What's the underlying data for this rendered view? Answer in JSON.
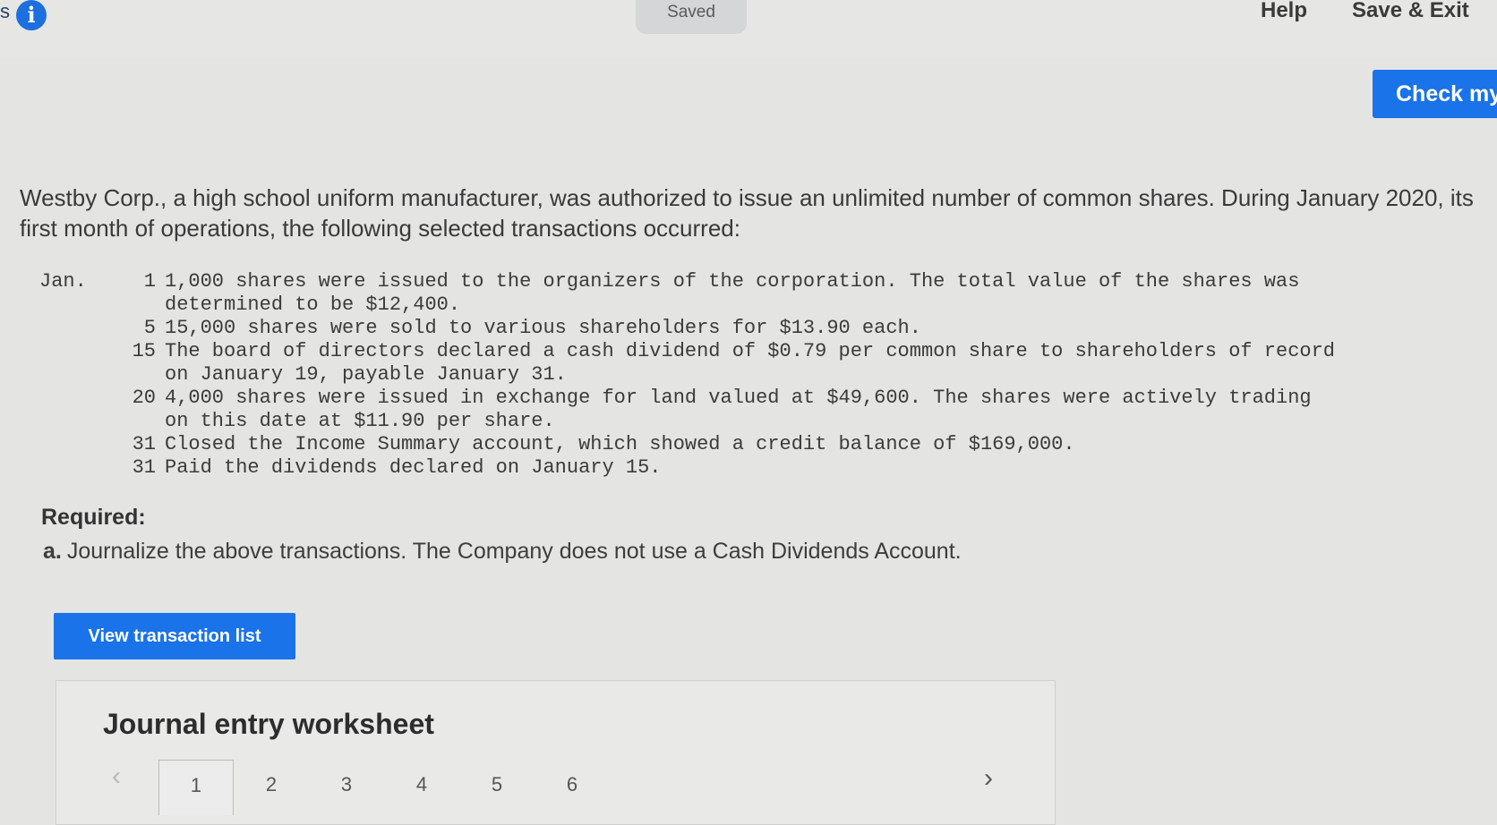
{
  "topbar": {
    "edge_char": "s",
    "info_icon": "info-icon",
    "saved_label": "Saved",
    "help_label": "Help",
    "save_exit_label": "Save & Exit"
  },
  "check_button_label": "Check my",
  "intro_text": "Westby Corp., a high school uniform manufacturer, was authorized to issue an unlimited number of common shares. During January 2020, its first month of operations, the following selected transactions occurred:",
  "transactions": {
    "month": "Jan.",
    "rows": [
      {
        "day": "1",
        "text": "1,000 shares were issued to the organizers of the corporation. The total value of the shares was determined to be $12,400."
      },
      {
        "day": "5",
        "text": "15,000 shares were sold to various shareholders for $13.90 each."
      },
      {
        "day": "15",
        "text": "The board of directors declared a cash dividend of $0.79 per common share to shareholders of record on January 19, payable January 31."
      },
      {
        "day": "20",
        "text": "4,000 shares were issued in exchange for land valued at $49,600. The shares were actively trading on this date at $11.90 per share."
      },
      {
        "day": "31",
        "text": "Closed the Income Summary account, which showed a credit balance of $169,000."
      },
      {
        "day": "31",
        "text": "Paid the dividends declared on January 15."
      }
    ]
  },
  "required": {
    "heading": "Required:",
    "item_letter": "a.",
    "item_text": "Journalize the above transactions. The Company does not use a Cash Dividends Account."
  },
  "view_transaction_list_label": "View transaction list",
  "worksheet": {
    "title": "Journal entry worksheet",
    "prev_icon": "chevron-left-icon",
    "next_icon": "chevron-right-icon",
    "tabs": [
      "1",
      "2",
      "3",
      "4",
      "5",
      "6"
    ],
    "active_tab": "1"
  }
}
